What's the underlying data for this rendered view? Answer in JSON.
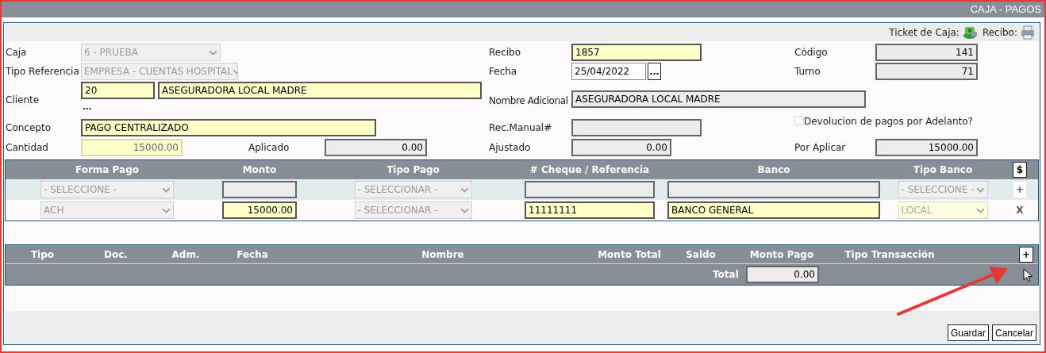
{
  "window": {
    "title": "CAJA - PAGOS"
  },
  "toolbar": {
    "ticket_label": "Ticket de Caja:",
    "recibo_label": "Recibo:"
  },
  "form": {
    "caja": {
      "label": "Caja",
      "kind": "select",
      "value": "6 - PRUEBA"
    },
    "recibo": {
      "label": "Recibo",
      "kind": "required",
      "value": "1857"
    },
    "codigo": {
      "label": "Código",
      "kind": "readonly",
      "value": "141"
    },
    "tipo_referencia": {
      "label": "Tipo Referencia",
      "kind": "select",
      "value": "EMPRESA - CUENTAS HOSPITAL"
    },
    "fecha": {
      "label": "Fecha",
      "kind": "plain",
      "value": "25/04/2022",
      "picker": "..."
    },
    "turno": {
      "label": "Turno",
      "kind": "readonly",
      "value": "71"
    },
    "cliente": {
      "label": "Cliente",
      "code": {
        "kind": "required",
        "value": "20"
      },
      "name": {
        "kind": "required",
        "value": "ASEGURADORA LOCAL MADRE"
      },
      "lookup": "..."
    },
    "nombre_adicional": {
      "label": "Nombre Adicional",
      "kind": "readonly",
      "value": "ASEGURADORA LOCAL MADRE"
    },
    "concepto": {
      "label": "Concepto",
      "kind": "required",
      "value": "PAGO CENTRALIZADO"
    },
    "rec_manual": {
      "label": "Rec.Manual#",
      "kind": "readonly"
    },
    "devolucion": {
      "label": "Devolucion de pagos por Adelanto?",
      "checked": false,
      "disabled": true
    },
    "cantidad": {
      "label": "Cantidad",
      "kind": "locked",
      "value": "15000.00"
    },
    "aplicado": {
      "label": "Aplicado",
      "kind": "readonly",
      "value": "0.00"
    },
    "ajustado": {
      "label": "Ajustado",
      "kind": "readonly",
      "value": "0.00"
    },
    "por_aplicar": {
      "label": "Por Aplicar",
      "kind": "readonly",
      "value": "15000.00"
    }
  },
  "payments": {
    "columns": [
      "Forma Pago",
      "Monto",
      "Tipo Pago",
      "# Cheque / Referencia",
      "Banco",
      "Tipo Banco"
    ],
    "header_button": "$",
    "rows": [
      {
        "kind": "new",
        "action": "+",
        "cells": [
          {
            "kind": "select",
            "value": "- SELECCIONE -"
          },
          {
            "kind": "readonly"
          },
          {
            "kind": "select",
            "value": "- SELECCIONAR -"
          },
          {
            "kind": "readonly"
          },
          {
            "kind": "readonly"
          },
          {
            "kind": "select",
            "value": "- SELECCIONE -"
          }
        ]
      },
      {
        "kind": "entry",
        "action": "X",
        "cells": [
          {
            "kind": "select",
            "value": "ACH"
          },
          {
            "kind": "required",
            "value": "15000.00"
          },
          {
            "kind": "select",
            "value": "- SELECCIONAR -"
          },
          {
            "kind": "required",
            "value": "11111111"
          },
          {
            "kind": "required",
            "value": "BANCO GENERAL"
          },
          {
            "kind": "select_required",
            "value": "LOCAL"
          }
        ]
      }
    ]
  },
  "documents": {
    "columns": [
      "Tipo",
      "Doc.",
      "Adm.",
      "Fecha",
      "Nombre",
      "Monto Total",
      "Saldo",
      "Monto Pago",
      "Tipo Transacción"
    ],
    "add_button": "+",
    "total_label": "Total",
    "total_value": "0.00"
  },
  "buttons": [
    "Guardar",
    "Cancelar"
  ]
}
